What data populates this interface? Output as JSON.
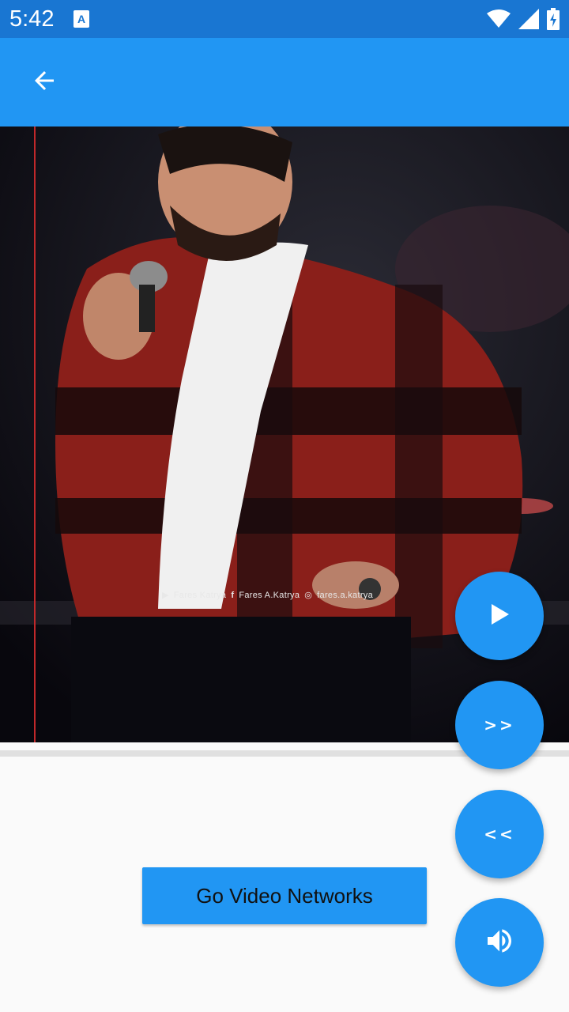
{
  "status_bar": {
    "time": "5:42",
    "icons": [
      "notification-a-icon",
      "wifi-icon",
      "signal-icon",
      "battery-charging-icon"
    ]
  },
  "app_bar": {
    "back_icon": "arrow-back-icon",
    "color": "#2196f3"
  },
  "video": {
    "watermark": {
      "youtube": "Fares Katrya",
      "facebook": "Fares A.Katrya",
      "instagram": "fares.a.katrya"
    }
  },
  "main": {
    "go_button_label": "Go Video Networks"
  },
  "controls": {
    "play_icon": "play-icon",
    "forward_label": ">>",
    "rewind_label": "<<",
    "volume_icon": "volume-icon"
  },
  "colors": {
    "primary": "#2196f3",
    "status_bar": "#1976d2",
    "background": "#fafafa"
  }
}
